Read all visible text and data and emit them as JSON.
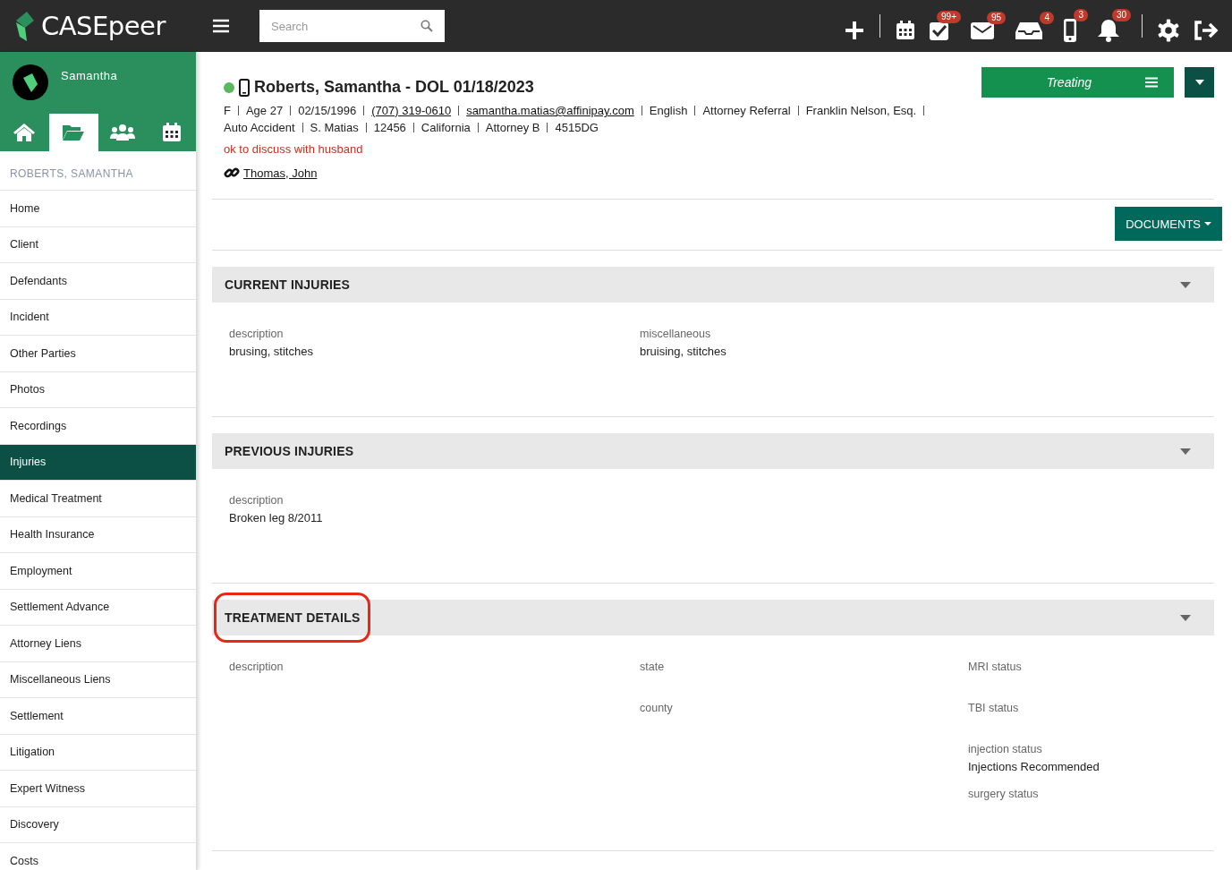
{
  "top_bar": {
    "logo": "CASEpeer",
    "search": {
      "placeholder": "Search"
    },
    "actions": [
      {
        "kind": "plus"
      },
      {
        "kind": "divider"
      },
      {
        "kind": "calendar"
      },
      {
        "kind": "tasks",
        "badge": "99+"
      },
      {
        "kind": "mail",
        "badge": "95"
      },
      {
        "kind": "inbox",
        "badge": "4"
      },
      {
        "kind": "phone",
        "badge": "3"
      },
      {
        "kind": "bell",
        "badge": "30"
      },
      {
        "kind": "divider"
      },
      {
        "kind": "gear"
      },
      {
        "kind": "logout"
      }
    ]
  },
  "sidebar": {
    "user": "Samantha",
    "tabs": [
      {
        "kind": "home",
        "selected": false
      },
      {
        "kind": "folder",
        "selected": true
      },
      {
        "kind": "people",
        "selected": false
      },
      {
        "kind": "calendar",
        "selected": false
      }
    ],
    "case_name": "ROBERTS, SAMANTHA",
    "items": [
      {
        "label": "Home",
        "selected": false
      },
      {
        "label": "Client",
        "selected": false
      },
      {
        "label": "Defendants",
        "selected": false
      },
      {
        "label": "Incident",
        "selected": false
      },
      {
        "label": "Other Parties",
        "selected": false
      },
      {
        "label": "Photos",
        "selected": false
      },
      {
        "label": "Recordings",
        "selected": false
      },
      {
        "label": "Injuries",
        "selected": true
      },
      {
        "label": "Medical Treatment",
        "selected": false
      },
      {
        "label": "Health Insurance",
        "selected": false
      },
      {
        "label": "Employment",
        "selected": false
      },
      {
        "label": "Settlement Advance",
        "selected": false
      },
      {
        "label": "Attorney Liens",
        "selected": false
      },
      {
        "label": "Miscellaneous Liens",
        "selected": false
      },
      {
        "label": "Settlement",
        "selected": false
      },
      {
        "label": "Litigation",
        "selected": false
      },
      {
        "label": "Expert Witness",
        "selected": false
      },
      {
        "label": "Discovery",
        "selected": false
      },
      {
        "label": "Costs",
        "selected": false
      }
    ]
  },
  "case": {
    "online": true,
    "title": "Roberts, Samantha - DOL 01/18/2023",
    "details": [
      {
        "text": "F",
        "link": false
      },
      {
        "text": "Age 27",
        "link": false
      },
      {
        "text": "02/15/1996",
        "link": false
      },
      {
        "text": "(707) 319-0610",
        "link": true
      },
      {
        "text": "samantha.matias@affinipay.com",
        "link": true
      },
      {
        "text": "English",
        "link": false
      },
      {
        "text": "Attorney Referral",
        "link": false
      },
      {
        "text": "Franklin Nelson, Esq.",
        "link": false
      },
      {
        "text": "Auto Accident",
        "link": false
      },
      {
        "text": "S. Matias",
        "link": false
      },
      {
        "text": "12456",
        "link": false
      },
      {
        "text": "California",
        "link": false
      },
      {
        "text": "Attorney B",
        "link": false
      },
      {
        "text": "4515DG",
        "link": false
      }
    ],
    "note": "ok to discuss with husband",
    "related": "Thomas, John",
    "status": "Treating",
    "documents_button": "DOCUMENTS"
  },
  "sections": [
    {
      "title": "CURRENT INJURIES",
      "highlighted": false,
      "columns": [
        [
          {
            "label": "description",
            "value": "brusing, stitches"
          }
        ],
        [
          {
            "label": "miscellaneous",
            "value": "bruising, stitches"
          }
        ]
      ]
    },
    {
      "title": "PREVIOUS INJURIES",
      "highlighted": false,
      "columns": [
        [
          {
            "label": "description",
            "value": "Broken leg 8/2011"
          }
        ]
      ]
    },
    {
      "title": "TREATMENT DETAILS",
      "highlighted": true,
      "columns": [
        [
          {
            "label": "description"
          }
        ],
        [
          {
            "label": "state"
          },
          {
            "label": "county"
          }
        ],
        [
          {
            "label": "MRI status"
          },
          {
            "label": "TBI status"
          },
          {
            "label": "injection status",
            "value": "Injections Recommended"
          },
          {
            "label": "surgery status"
          }
        ]
      ]
    }
  ]
}
